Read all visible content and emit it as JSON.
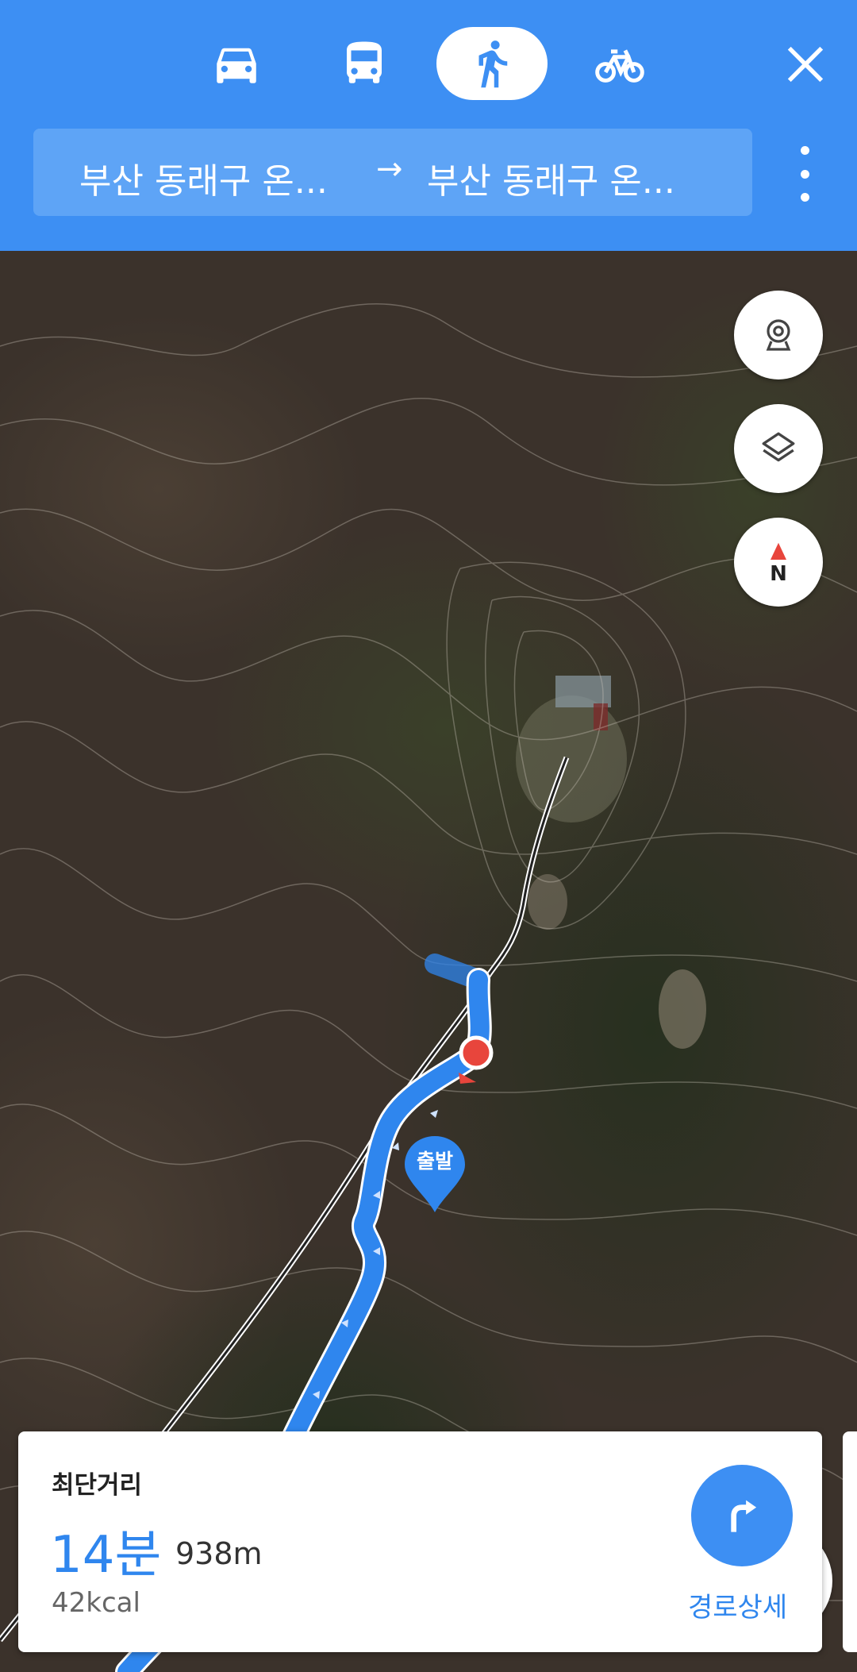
{
  "modes": [
    {
      "icon": "car-icon",
      "active": false
    },
    {
      "icon": "bus-icon",
      "active": false
    },
    {
      "icon": "walk-icon",
      "active": true
    },
    {
      "icon": "bike-icon",
      "active": false
    }
  ],
  "route": {
    "origin": "부산 동래구 온...",
    "arrow": "→",
    "destination": "부산 동래구 온..."
  },
  "map": {
    "start_marker_label": "출발",
    "compass_label": "N",
    "colors": {
      "route_blue": "#2f86ee",
      "accent_blue": "#3d8ff3",
      "current_location_red": "#e8453c"
    }
  },
  "summary": {
    "type": "최단거리",
    "time": "14분",
    "distance": "938m",
    "calories": "42kcal",
    "detail_button": "경로상세"
  }
}
